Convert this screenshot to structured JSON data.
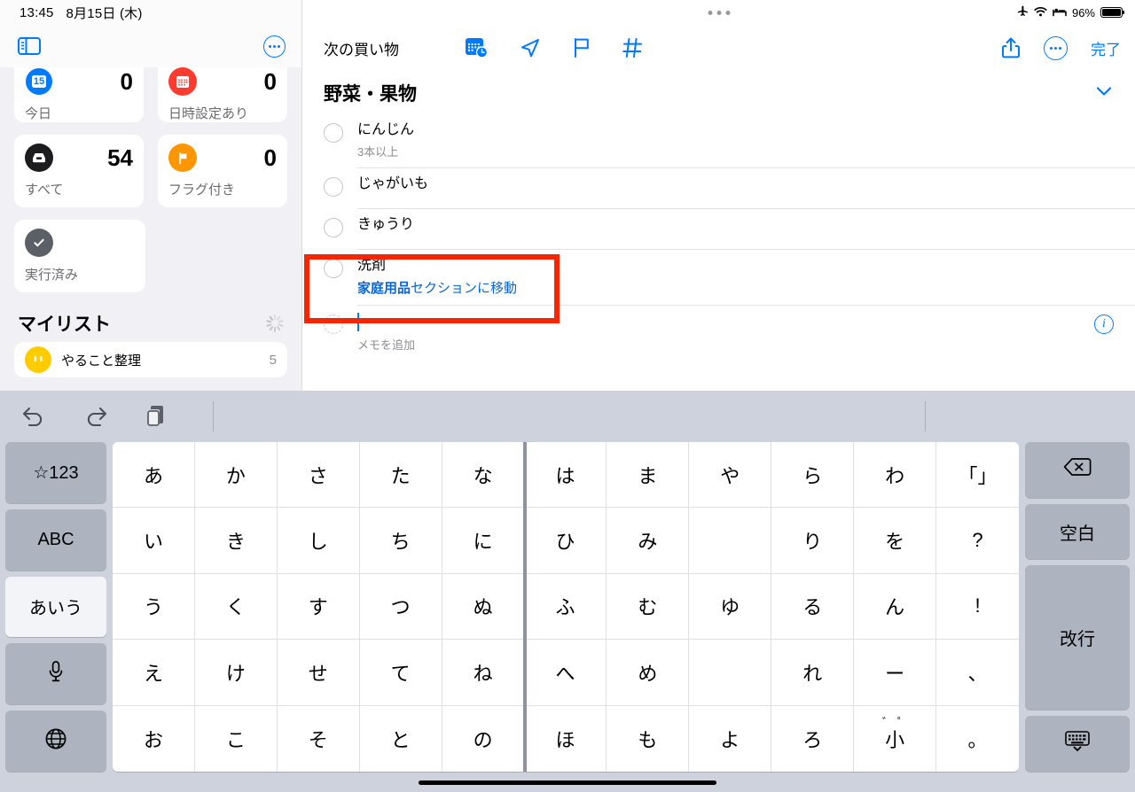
{
  "sidebar": {
    "status": {
      "time": "13:45",
      "date": "8月15日 (木)"
    },
    "toggle_icon": "sidebar-toggle-icon",
    "more_icon": "more-ellipsis-icon",
    "cards": [
      {
        "icon": "calendar-today-icon",
        "badge_text": "15",
        "count": "0",
        "label": "今日",
        "color": "#007aff"
      },
      {
        "icon": "calendar-scheduled-icon",
        "badge_text": "",
        "count": "0",
        "label": "日時設定あり",
        "color": "#ff3b30"
      },
      {
        "icon": "inbox-all-icon",
        "badge_text": "",
        "count": "54",
        "label": "すべて",
        "color": "#1c1c1e"
      },
      {
        "icon": "flag-icon",
        "badge_text": "",
        "count": "0",
        "label": "フラグ付き",
        "color": "#ff9500"
      },
      {
        "icon": "checkmark-circle-icon",
        "badge_text": "",
        "count": "",
        "label": "実行済み",
        "color": "#5b6067"
      }
    ],
    "mylists": {
      "title": "マイリスト",
      "spinner_icon": "loading-spinner-icon"
    },
    "lists": [
      {
        "name": "やること整理",
        "count": "5",
        "icon": "list-circle-icon",
        "color": "#ffcc00"
      }
    ]
  },
  "detail": {
    "status": {
      "airplane_icon": "airplane-mode-icon",
      "wifi_icon": "wifi-icon",
      "focus_icon": "sleep-focus-icon",
      "battery_percent": "96%",
      "battery_icon": "battery-icon"
    },
    "grabber_icon": "window-grabber-icon",
    "title": "次の買い物",
    "toolbar": [
      {
        "name": "add-date-time-icon",
        "label": "calendar-clock-icon"
      },
      {
        "name": "add-location-icon",
        "label": "location-arrow-icon"
      },
      {
        "name": "add-flag-icon",
        "label": "flag-outline-icon"
      },
      {
        "name": "add-tag-icon",
        "label": "hashtag-icon"
      }
    ],
    "share_icon": "share-icon",
    "more_icon": "more-ellipsis-icon",
    "done_label": "完了",
    "section": {
      "title": "野菜・果物",
      "chevron_icon": "chevron-down-icon"
    },
    "items": [
      {
        "title": "にんじん",
        "sub": "3本以上",
        "move_bold": "",
        "move_rest": ""
      },
      {
        "title": "じゃがいも",
        "sub": "",
        "move_bold": "",
        "move_rest": ""
      },
      {
        "title": "きゅうり",
        "sub": "",
        "move_bold": "",
        "move_rest": ""
      },
      {
        "title": "洗剤",
        "sub": "",
        "move_bold": "家庭用品",
        "move_rest": "セクションに移動"
      }
    ],
    "new_item": {
      "value": "",
      "note_placeholder": "メモを追加",
      "info_icon": "info-circle-icon"
    },
    "highlight_color": "#f72500"
  },
  "keyboard": {
    "toolbar": [
      {
        "name": "undo-icon",
        "glyph": "↶"
      },
      {
        "name": "redo-icon",
        "glyph": "↷"
      },
      {
        "name": "paste-icon",
        "glyph": ""
      }
    ],
    "left_keys": [
      {
        "label": "☆123",
        "name": "key-symbols-123",
        "active": false
      },
      {
        "label": "ABC",
        "name": "key-abc",
        "active": false
      },
      {
        "label": "あいう",
        "name": "key-aiu",
        "active": true
      },
      {
        "label": "",
        "name": "key-dictation-mic",
        "active": false,
        "icon": "microphone-icon"
      },
      {
        "label": "",
        "name": "key-globe",
        "active": false,
        "icon": "globe-icon"
      }
    ],
    "right_keys": [
      {
        "label": "",
        "name": "key-delete",
        "icon": "delete-backward-icon"
      },
      {
        "label": "空白",
        "name": "key-space"
      },
      {
        "label": "改行",
        "name": "key-return"
      },
      {
        "label": "",
        "name": "key-hide-keyboard",
        "icon": "hide-keyboard-icon"
      }
    ],
    "kana_rows": [
      [
        "あ",
        "か",
        "さ",
        "た",
        "な",
        "は",
        "ま",
        "や",
        "ら",
        "わ",
        "「」"
      ],
      [
        "い",
        "き",
        "し",
        "ち",
        "に",
        "ひ",
        "み",
        "",
        "り",
        "を",
        "?"
      ],
      [
        "う",
        "く",
        "す",
        "つ",
        "ぬ",
        "ふ",
        "む",
        "ゆ",
        "る",
        "ん",
        "!"
      ],
      [
        "え",
        "け",
        "せ",
        "て",
        "ね",
        "へ",
        "め",
        "",
        "れ",
        "ー",
        "、"
      ],
      [
        "お",
        "こ",
        "そ",
        "と",
        "の",
        "ほ",
        "も",
        "よ",
        "ろ",
        "小",
        "。"
      ]
    ],
    "small_kana_marks": "゛゜"
  }
}
